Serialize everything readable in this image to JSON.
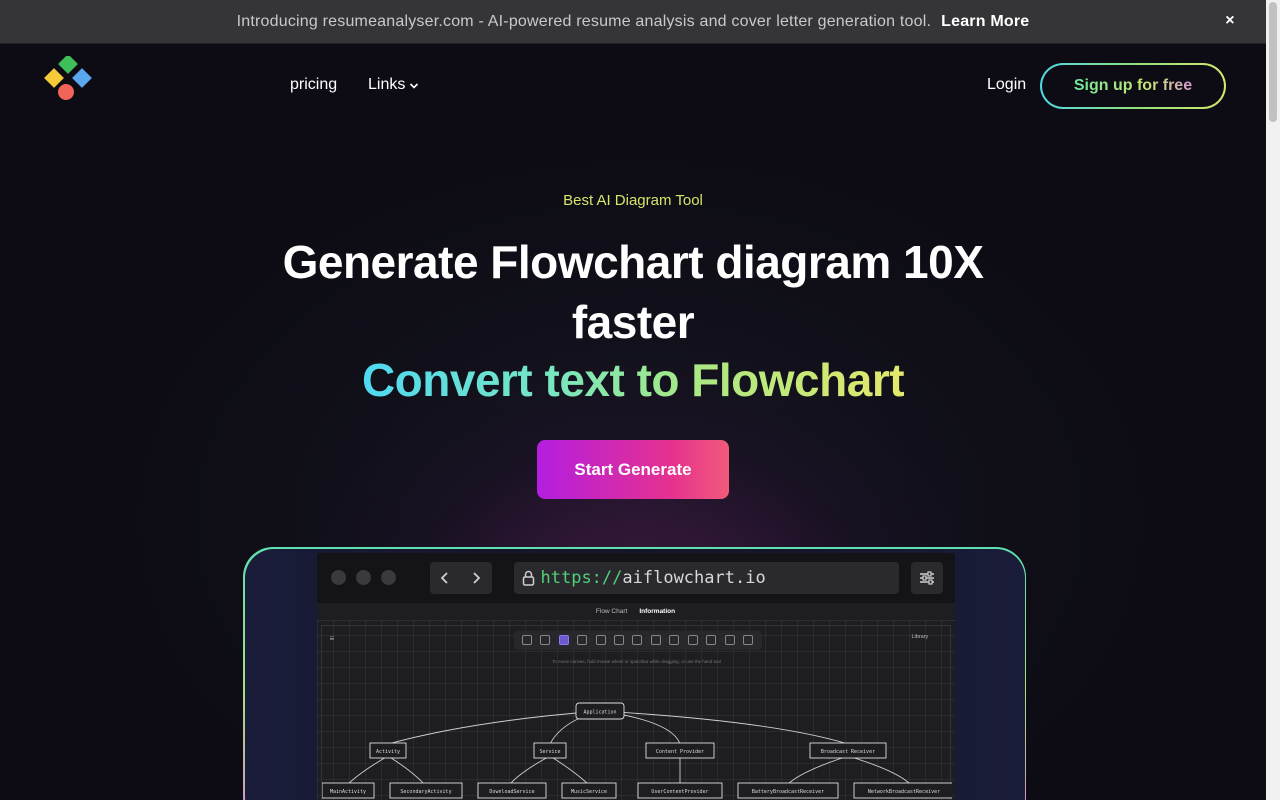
{
  "announcement": {
    "message": "Introducing resumeanalyser.com - AI-powered resume analysis and cover letter generation tool.",
    "link": "Learn More",
    "close": "×"
  },
  "nav": {
    "pricing": "pricing",
    "links": "Links",
    "login": "Login",
    "signup": "Sign up for free"
  },
  "hero": {
    "eyebrow": "Best AI Diagram Tool",
    "title_line1": "Generate Flowchart diagram 10X",
    "title_line2": "faster",
    "gradient_title": "Convert text to Flowchart",
    "cta": "Start Generate"
  },
  "preview": {
    "url_protocol": "https://",
    "url_host": "aiflowchart.io",
    "tabs": [
      "Flow Chart",
      "Information"
    ],
    "library": "Library",
    "hint": "To move canvas, hold mouse wheel or spacebar while dragging, or use the hand tool",
    "nodes": {
      "root": "Application",
      "level1": [
        "Activity",
        "Service",
        "Content Provider",
        "Broadcast Receiver"
      ],
      "level2": [
        "MainActivity",
        "SecondaryActivity",
        "DownloadService",
        "MusicService",
        "UserContentProvider",
        "BatteryBroadcastReceiver",
        "NetworkBroadcastReceiver"
      ]
    }
  },
  "colors": {
    "background": "#0d0c14",
    "announcement_bg": "#353437",
    "eyebrow": "#d9e46a",
    "cta_start": "#b31ee0",
    "cta_end": "#f25a7a"
  }
}
